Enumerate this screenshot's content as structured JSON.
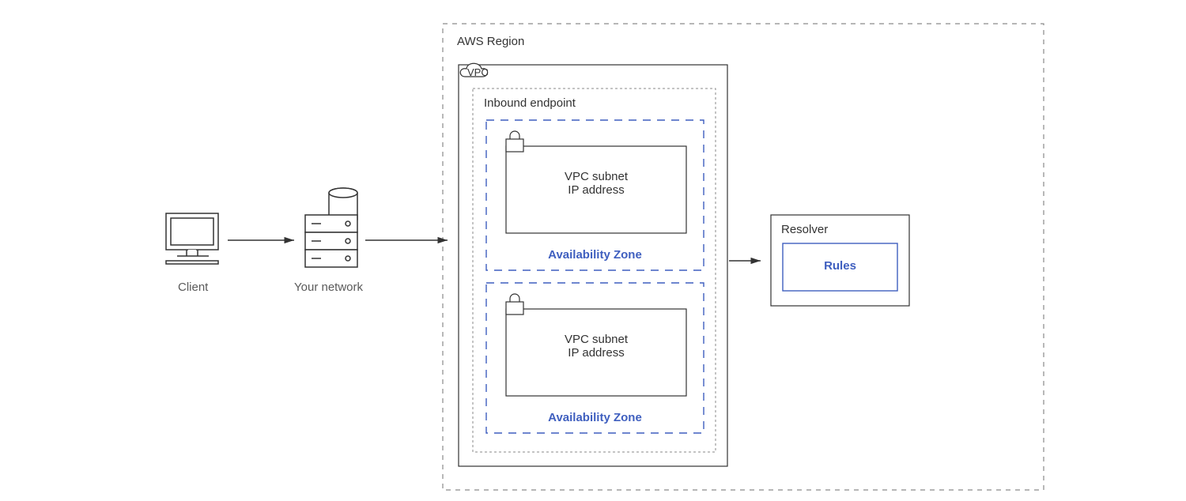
{
  "labels": {
    "client": "Client",
    "network": "Your network",
    "region": "AWS Region",
    "vpc": "VPC",
    "inbound": "Inbound endpoint",
    "subnet1_l1": "VPC subnet",
    "subnet1_l2": "IP address",
    "az1": "Availability Zone",
    "subnet2_l1": "VPC subnet",
    "subnet2_l2": "IP address",
    "az2": "Availability Zone",
    "resolver": "Resolver",
    "rules": "Rules"
  },
  "colors": {
    "gray": "#8a8a8a",
    "dark": "#333333",
    "blue": "#3f5fbf",
    "text": "#5a5a5a"
  }
}
